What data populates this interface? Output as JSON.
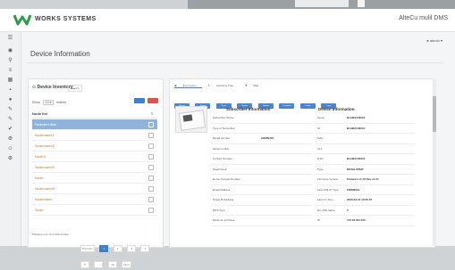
{
  "app": {
    "brand": "WORKS SYSTEMS",
    "title": "AlteCu mulil DMS"
  },
  "page": {
    "title": "Device Information"
  },
  "inventory": {
    "header": "Device Inventory",
    "tag": "Search",
    "show_label": "Show",
    "show_value": "10",
    "entries_label": "entries",
    "column_header": "Node list",
    "rows": [
      {
        "name": "Selected Item",
        "selected": true
      },
      {
        "name": "Nodename1",
        "selected": false
      },
      {
        "name": "Nodename2",
        "selected": false
      },
      {
        "name": "Node3",
        "selected": false
      },
      {
        "name": "Nodename5",
        "selected": false
      },
      {
        "name": "Node",
        "selected": false
      },
      {
        "name": "Nodename6",
        "selected": false
      },
      {
        "name": "Nodename",
        "selected": false
      },
      {
        "name": "Node",
        "selected": false
      }
    ],
    "footer": "Showing 1 to 10 of 100 entries",
    "pager": [
      "Previous",
      "1",
      "2",
      "3",
      "4",
      "5",
      "...",
      "10",
      "Next"
    ],
    "pager_active": "1"
  },
  "detail": {
    "tabs": [
      {
        "label": "Information",
        "active": true
      },
      {
        "label": "Inventory Tree",
        "active": false
      },
      {
        "label": "Map",
        "active": false
      }
    ],
    "toolbar": [
      "Refresh",
      "Reboot",
      "Reset",
      "Update",
      "Upload",
      "Download",
      "Config",
      "Logs"
    ],
    "subscriber": {
      "title": "Subscriber Information",
      "rows": [
        {
          "k": "Subscriber Name",
          "v": ""
        },
        {
          "k": "Type of Subscriber",
          "v": ""
        },
        {
          "k": "Model number",
          "v": "ARMN410"
        },
        {
          "k": "Serial number",
          "v": ""
        },
        {
          "k": "Contact Number",
          "v": ""
        },
        {
          "k": "Telephone#",
          "v": ""
        },
        {
          "k": "Home Contact Number",
          "v": ""
        },
        {
          "k": "Email Address",
          "v": ""
        },
        {
          "k": "Street IP Address",
          "v": ""
        },
        {
          "k": "DNS Type",
          "v": ""
        },
        {
          "k": "Mode de synthèse",
          "v": ""
        }
      ]
    },
    "device": {
      "title": "Device Information",
      "rows": [
        {
          "k": "Serial",
          "v": "B1ABA040010"
        },
        {
          "k": "ID",
          "v": "B1ABA040010"
        },
        {
          "k": "MAC",
          "v": ""
        },
        {
          "k": "OUI",
          "v": ""
        },
        {
          "k": "GSO",
          "v": "B1ABA040010"
        },
        {
          "k": "Type",
          "v": "DEVELOPER"
        },
        {
          "k": "Firmware Version",
          "v": "firmware v1.10 Rev x1.04"
        },
        {
          "k": "Last CPE IP Type",
          "v": "CRIMINAL"
        },
        {
          "k": "Last On Time",
          "v": "2020-03-21 10:05:07"
        },
        {
          "k": "Do CPE Name",
          "v": "0"
        },
        {
          "k": "IP",
          "v": "172.16.001.150"
        }
      ]
    }
  },
  "user": {
    "label": "admin"
  }
}
